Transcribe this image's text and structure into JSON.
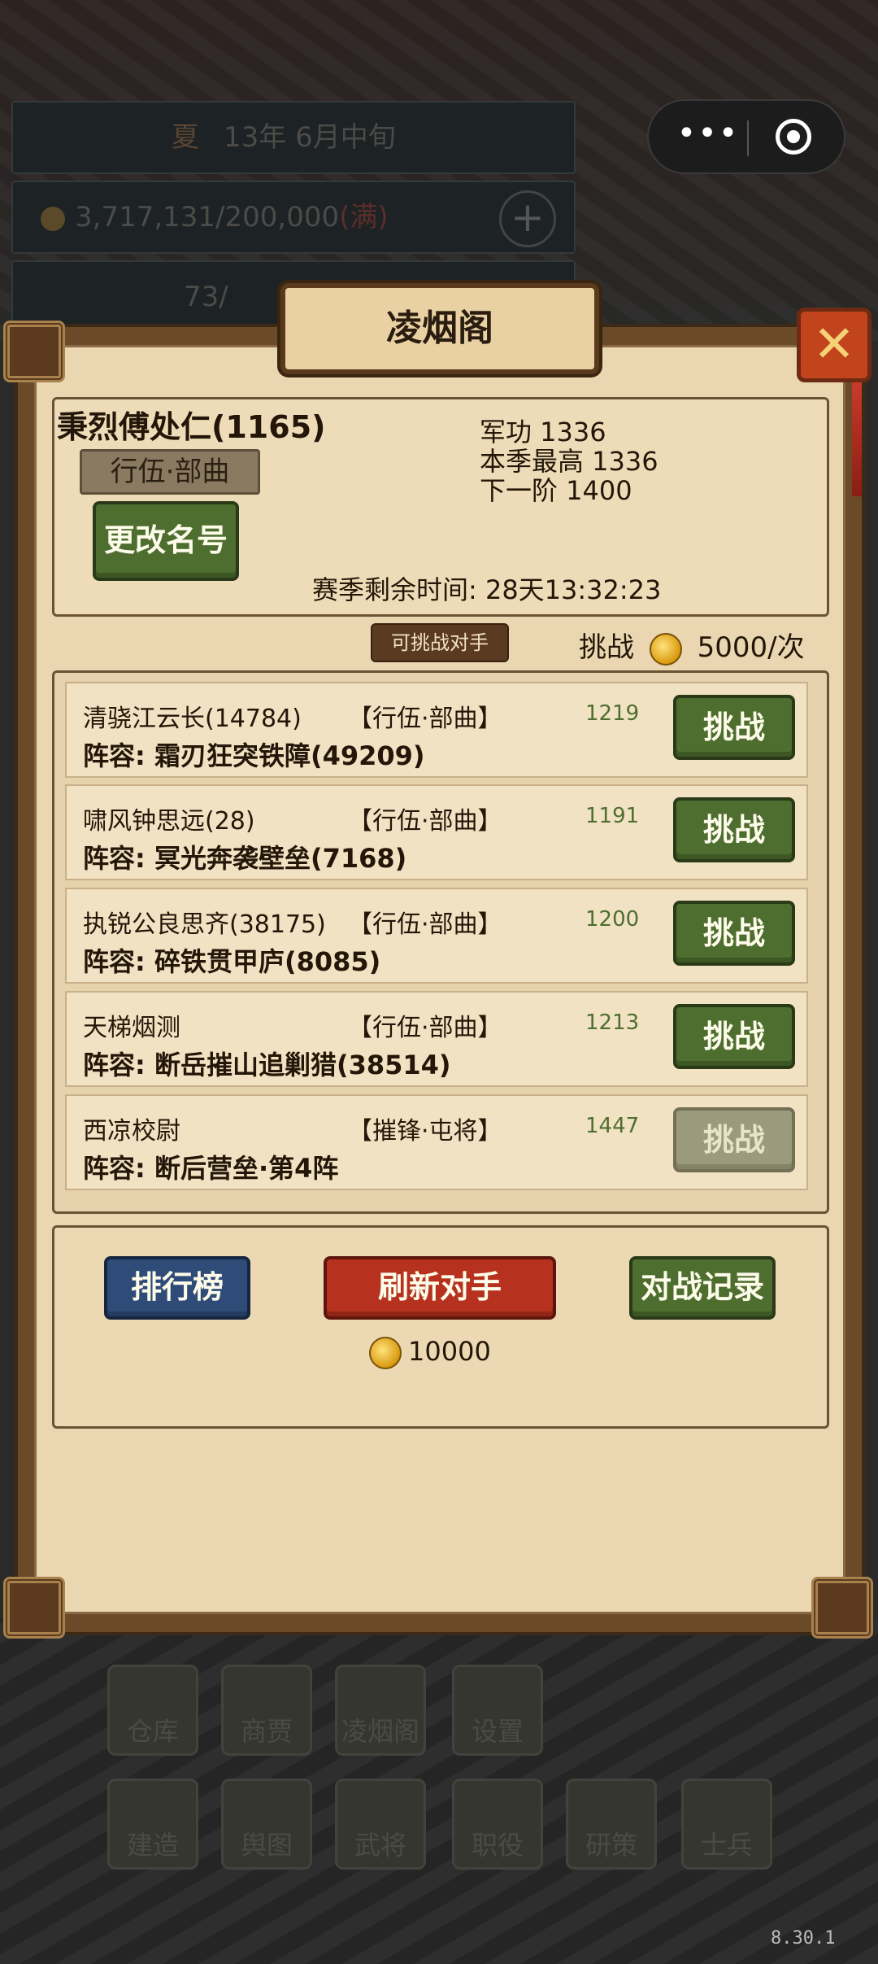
{
  "hud": {
    "date_season": "夏",
    "date_text": "13年 6月中旬",
    "resource_text": "3,717,131/200,000",
    "resource_status": "(满)",
    "population_text": "73/"
  },
  "panel": {
    "title": "凌烟阁",
    "close_symbol": "✕"
  },
  "player": {
    "name": "秉烈傅处仁(1165)",
    "rank": "行伍·部曲",
    "merit": "军功 1336",
    "season_best": "本季最高 1336",
    "next_tier": "下一阶 1400",
    "rename_label": "更改名号",
    "season_remaining": "赛季剩余时间: 28天13:32:23"
  },
  "challenge": {
    "section_label": "可挑战对手",
    "cost_prefix": "挑战",
    "cost_text": "5000/次"
  },
  "opponents": [
    {
      "name": "清骁江云长(14784)",
      "rank": "【行伍·部曲】",
      "score": "1219",
      "lineup": "阵容: 霜刃狂突铁障(49209)",
      "button": "挑战",
      "enabled": true
    },
    {
      "name": "啸风钟思远(28)",
      "rank": "【行伍·部曲】",
      "score": "1191",
      "lineup": "阵容: 冥光奔袭壁垒(7168)",
      "button": "挑战",
      "enabled": true
    },
    {
      "name": "执锐公良思齐(38175)",
      "rank": "【行伍·部曲】",
      "score": "1200",
      "lineup": "阵容: 碎铁贯甲庐(8085)",
      "button": "挑战",
      "enabled": true
    },
    {
      "name": "天梯烟测",
      "rank": "【行伍·部曲】",
      "score": "1213",
      "lineup": "阵容: 断岳摧山追剿猎(38514)",
      "button": "挑战",
      "enabled": true
    },
    {
      "name": "西凉校尉",
      "rank": "【摧锋·屯将】",
      "score": "1447",
      "lineup": "阵容: 断后营垒·第4阵",
      "button": "挑战",
      "enabled": false
    }
  ],
  "actions": {
    "leaderboard": "排行榜",
    "refresh": "刷新对手",
    "battle_log": "对战记录",
    "refresh_cost": "10000"
  },
  "menu": [
    {
      "label": "仓库",
      "icon": "warehouse-icon"
    },
    {
      "label": "商贾",
      "icon": "merchant-icon"
    },
    {
      "label": "凌烟阁",
      "icon": "swords-icon"
    },
    {
      "label": "设置",
      "icon": "gear-icon"
    },
    {
      "label": "建造",
      "icon": "hammer-icon"
    },
    {
      "label": "舆图",
      "icon": "map-icon"
    },
    {
      "label": "武将",
      "icon": "general-icon"
    },
    {
      "label": "职役",
      "icon": "worker-icon"
    },
    {
      "label": "研策",
      "icon": "scroll-icon"
    },
    {
      "label": "士兵",
      "icon": "soldier-icon"
    }
  ],
  "version": "8.30.1",
  "colors": {
    "panel_parchment": "#ead7b1",
    "button_green": "#4e6e2f",
    "button_blue": "#2f4c78",
    "button_red": "#b6321f",
    "close_red": "#c2441d",
    "score_green": "#4f6e2f"
  }
}
